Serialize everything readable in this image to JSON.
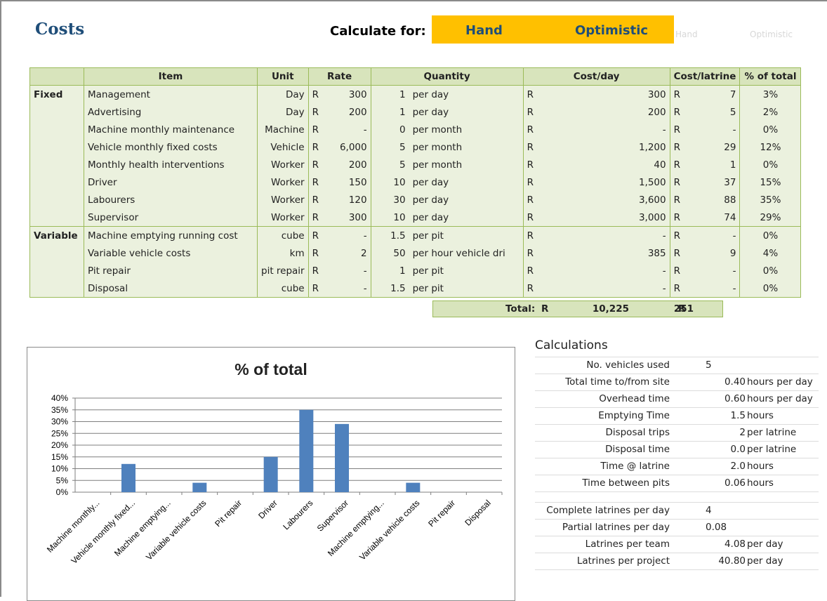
{
  "header": {
    "title": "Costs",
    "calculate_label": "Calculate for:",
    "option_1": "Hand",
    "option_2": "Optimistic",
    "ghost_1": "Hand",
    "ghost_2": "Optimistic"
  },
  "table": {
    "headers": [
      "Item",
      "Unit",
      "Rate",
      "Quantity",
      "Cost/day",
      "Cost/latrine",
      "% of total"
    ],
    "currency": "R",
    "rows": [
      {
        "group": "Fixed",
        "item": "Management",
        "unit": "Day",
        "rate": "300",
        "qty": "1",
        "qty_unit": "per day",
        "cost_day": "300",
        "cost_latrine": "7",
        "pct": "3%"
      },
      {
        "group": "",
        "item": "Advertising",
        "unit": "Day",
        "rate": "200",
        "qty": "1",
        "qty_unit": "per day",
        "cost_day": "200",
        "cost_latrine": "5",
        "pct": "2%"
      },
      {
        "group": "",
        "item": "Machine monthly maintenance",
        "unit": "Machine",
        "rate": "-",
        "qty": "0",
        "qty_unit": "per month",
        "cost_day": "-",
        "cost_latrine": "-",
        "pct": "0%"
      },
      {
        "group": "",
        "item": "Vehicle monthly fixed costs",
        "unit": "Vehicle",
        "rate": "6,000",
        "qty": "5",
        "qty_unit": "per month",
        "cost_day": "1,200",
        "cost_latrine": "29",
        "pct": "12%"
      },
      {
        "group": "",
        "item": "Monthly health interventions",
        "unit": "Worker",
        "rate": "200",
        "qty": "5",
        "qty_unit": "per month",
        "cost_day": "40",
        "cost_latrine": "1",
        "pct": "0%"
      },
      {
        "group": "",
        "item": "Driver",
        "unit": "Worker",
        "rate": "150",
        "qty": "10",
        "qty_unit": "per day",
        "cost_day": "1,500",
        "cost_latrine": "37",
        "pct": "15%"
      },
      {
        "group": "",
        "item": "Labourers",
        "unit": "Worker",
        "rate": "120",
        "qty": "30",
        "qty_unit": "per day",
        "cost_day": "3,600",
        "cost_latrine": "88",
        "pct": "35%"
      },
      {
        "group": "",
        "item": "Supervisor",
        "unit": "Worker",
        "rate": "300",
        "qty": "10",
        "qty_unit": "per day",
        "cost_day": "3,000",
        "cost_latrine": "74",
        "pct": "29%"
      },
      {
        "group": "Variable",
        "item": "Machine emptying running cost",
        "unit": "cube",
        "rate": "-",
        "qty": "1.5",
        "qty_unit": "per pit",
        "cost_day": "-",
        "cost_latrine": "-",
        "pct": "0%"
      },
      {
        "group": "",
        "item": "Variable vehicle costs",
        "unit": "km",
        "rate": "2",
        "qty": "50",
        "qty_unit": "per hour vehicle dri",
        "cost_day": "385",
        "cost_latrine": "9",
        "pct": "4%"
      },
      {
        "group": "",
        "item": "Pit repair",
        "unit": "pit repair",
        "rate": "-",
        "qty": "1",
        "qty_unit": "per pit",
        "cost_day": "-",
        "cost_latrine": "-",
        "pct": "0%"
      },
      {
        "group": "",
        "item": "Disposal",
        "unit": "cube",
        "rate": "-",
        "qty": "1.5",
        "qty_unit": "per pit",
        "cost_day": "-",
        "cost_latrine": "-",
        "pct": "0%"
      }
    ],
    "total_label": "Total:",
    "total_cost_day": "10,225",
    "total_cost_latrine": "251"
  },
  "chart_data": {
    "type": "bar",
    "title": "% of total",
    "categories": [
      "Machine monthly...",
      "Vehicle monthly fixed...",
      "Machine emptying...",
      "Variable vehicle costs",
      "Pit repair",
      "Driver",
      "Labourers",
      "Supervisor",
      "Machine emptying...",
      "Variable vehicle costs",
      "Pit repair",
      "Disposal"
    ],
    "values": [
      0,
      12,
      0,
      4,
      0,
      15,
      35,
      29,
      0,
      4,
      0,
      0
    ],
    "ylim": [
      0,
      40
    ],
    "yticks": [
      "0%",
      "5%",
      "10%",
      "15%",
      "20%",
      "25%",
      "30%",
      "35%",
      "40%"
    ],
    "xlabel": "",
    "ylabel": "",
    "grid": true,
    "bar_color": "#4f81bd"
  },
  "calculations": {
    "title": "Calculations",
    "rows": [
      {
        "label": "No. vehicles used",
        "value": "5",
        "unit": ""
      },
      {
        "label": "Total time to/from site",
        "value": "0.40",
        "unit": "hours per day"
      },
      {
        "label": "Overhead time",
        "value": "0.60",
        "unit": "hours per day"
      },
      {
        "label": "Emptying Time",
        "value": "1.5",
        "unit": "hours"
      },
      {
        "label": "Disposal trips",
        "value": "2",
        "unit": "per latrine"
      },
      {
        "label": "Disposal time",
        "value": "0.0",
        "unit": "per latrine"
      },
      {
        "label": "Time @ latrine",
        "value": "2.0",
        "unit": "hours"
      },
      {
        "label": "Time between pits",
        "value": "0.06",
        "unit": "hours"
      }
    ],
    "rows2": [
      {
        "label": "Complete latrines per day",
        "value": "4",
        "unit": ""
      },
      {
        "label": "Partial latrines per day",
        "value": "0.08",
        "unit": ""
      },
      {
        "label": "Latrines per team",
        "value": "4.08",
        "unit": "per day"
      },
      {
        "label": "Latrines per project",
        "value": "40.80",
        "unit": "per day"
      }
    ]
  }
}
